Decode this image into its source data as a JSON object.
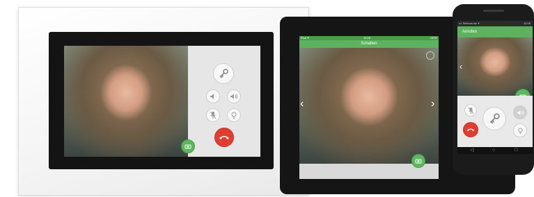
{
  "tablet": {
    "status_left": "iPad ✈",
    "status_center": "10:26",
    "status_right": "100%",
    "header_title": "Schalten",
    "prev_glyph": "‹",
    "next_glyph": "›"
  },
  "phone": {
    "status_left": "••• Telekom.de ✈",
    "status_right": "10:26",
    "header_title": "Anrufen",
    "prev_glyph": "‹"
  },
  "colors": {
    "accent_green": "#5db25d",
    "hangup_red": "#e03c2f"
  },
  "icons": [
    "key-icon",
    "speaker-icon",
    "volume-icon",
    "mute-mic-icon",
    "light-icon",
    "hangup-icon",
    "camera-icon"
  ]
}
